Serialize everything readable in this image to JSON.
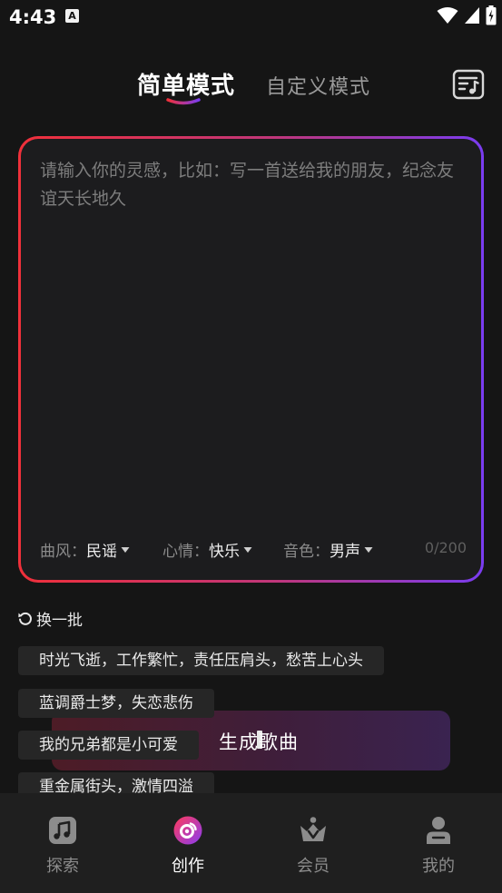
{
  "status_bar": {
    "time": "4:43",
    "notification_glyph": "A"
  },
  "header": {
    "tabs": [
      {
        "label": "简单模式",
        "active": true
      },
      {
        "label": "自定义模式",
        "active": false
      }
    ],
    "playlist_icon": "music-list-icon"
  },
  "input": {
    "placeholder": "请输入你的灵感，比如：写一首送给我的朋友，纪念友谊天长地久",
    "value": "",
    "char_count": "0/200",
    "options": [
      {
        "label": "曲风：",
        "value": "民谣"
      },
      {
        "label": "心情：",
        "value": "快乐"
      },
      {
        "label": "音色：",
        "value": "男声"
      }
    ]
  },
  "refresh_label": "换一批",
  "generate_label": "生成歌曲",
  "suggestions": [
    "时光飞逝，工作繁忙，责任压肩头，愁苦上心头",
    "蓝调爵士梦，失恋悲伤",
    "我的兄弟都是小可爱",
    "重金属街头，激情四溢"
  ],
  "bottom_nav": {
    "items": [
      {
        "label": "探索",
        "icon": "music-note-icon",
        "active": false
      },
      {
        "label": "创作",
        "icon": "vinyl-disc-icon",
        "active": true
      },
      {
        "label": "会员",
        "icon": "crown-icon",
        "active": false
      },
      {
        "label": "我的",
        "icon": "person-icon",
        "active": false
      }
    ]
  },
  "colors": {
    "background": "#151515",
    "gradient_start": "#f0303a",
    "gradient_end": "#7a3cf0"
  }
}
